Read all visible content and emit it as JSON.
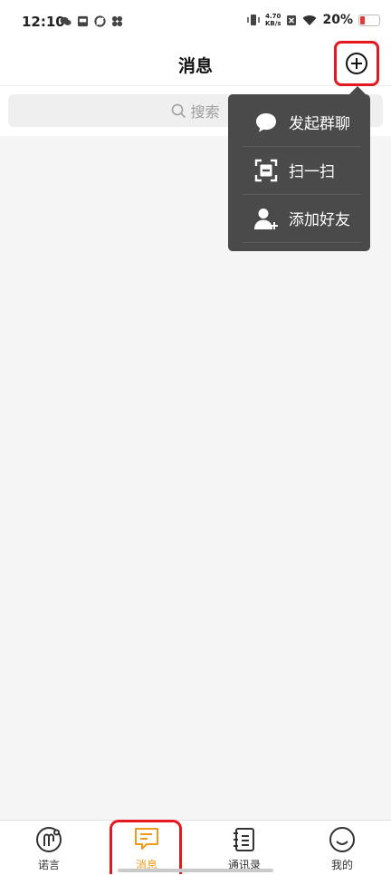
{
  "status_bar": {
    "time": "12:10",
    "net_speed_value": "4.70",
    "net_speed_unit": "KB/s",
    "battery_percent": "20%",
    "battery_color": "#e53935"
  },
  "header": {
    "title": "消息",
    "add_icon": "plus-circle-icon"
  },
  "search": {
    "placeholder": "搜索"
  },
  "popup_menu": {
    "items": [
      {
        "label": "发起群聊",
        "icon": "chat-bubble-icon"
      },
      {
        "label": "扫一扫",
        "icon": "scan-icon"
      },
      {
        "label": "添加好友",
        "icon": "add-friend-icon"
      }
    ]
  },
  "bottom_nav": {
    "active_color": "#f09a1a",
    "items": [
      {
        "label": "诺言",
        "icon": "nuoyan-icon",
        "active": false
      },
      {
        "label": "消息",
        "icon": "message-icon",
        "active": true
      },
      {
        "label": "通讯录",
        "icon": "contacts-icon",
        "active": false
      },
      {
        "label": "我的",
        "icon": "profile-icon",
        "active": false
      }
    ]
  }
}
